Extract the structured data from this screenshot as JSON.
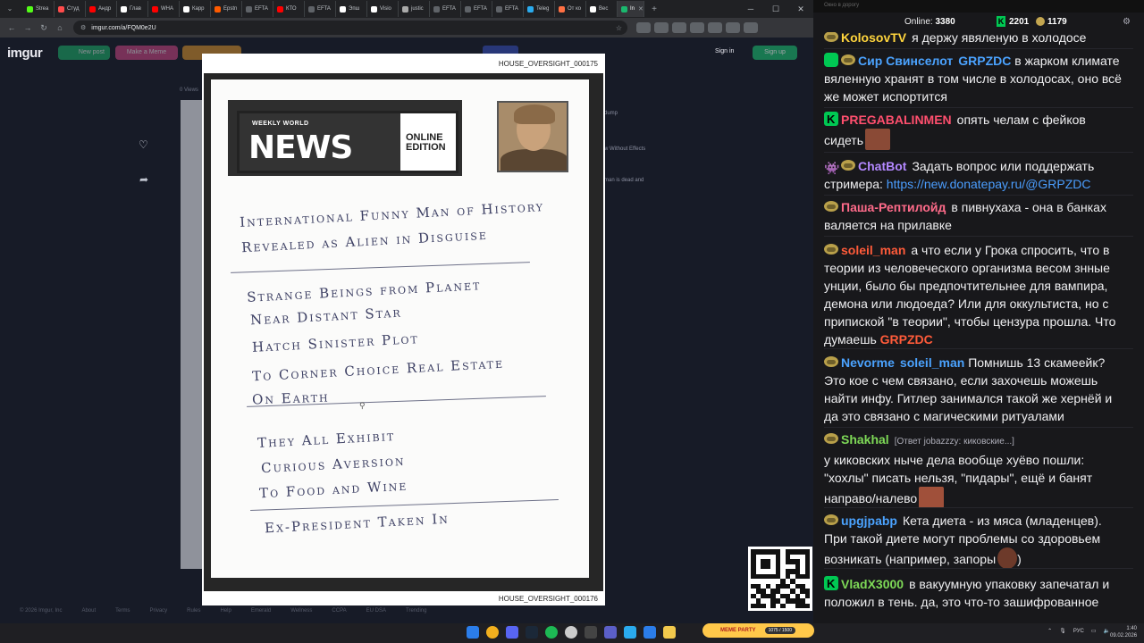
{
  "browser": {
    "tabs": [
      {
        "label": "Strea",
        "color": "#53fc18"
      },
      {
        "label": "Студ",
        "color": "#ff4b4b"
      },
      {
        "label": "Андр",
        "color": "#ff0000"
      },
      {
        "label": "Глав",
        "color": "#ffffff"
      },
      {
        "label": "WHA",
        "color": "#ff0000"
      },
      {
        "label": "Карр",
        "color": "#ffffff"
      },
      {
        "label": "Epstn",
        "color": "#ff5b00"
      },
      {
        "label": "EFTA",
        "color": "#5f6368"
      },
      {
        "label": "КТО",
        "color": "#ff0000"
      },
      {
        "label": "EFTA",
        "color": "#5f6368"
      },
      {
        "label": "Эпш",
        "color": "#ffffff"
      },
      {
        "label": "Visio",
        "color": "#ffffff"
      },
      {
        "label": "justic",
        "color": "#aaaaaa"
      },
      {
        "label": "EFTA",
        "color": "#5f6368"
      },
      {
        "label": "EFTA",
        "color": "#5f6368"
      },
      {
        "label": "EFTA",
        "color": "#5f6368"
      },
      {
        "label": "Teleg",
        "color": "#2aabee"
      },
      {
        "label": "От ко",
        "color": "#ff7043"
      },
      {
        "label": "Вес",
        "color": "#ffffff"
      },
      {
        "label": "In",
        "color": "#1bb76e"
      }
    ],
    "url": "imgur.com/a/FQM0e2U"
  },
  "imgur": {
    "logo": "imgur",
    "new_post": "New post",
    "make_meme": "Make a Meme",
    "views": "0 Views",
    "signin": "Sign in",
    "signup": "Sign up",
    "side_items": [
      "dump",
      "w Without Effects",
      "man is dead and"
    ],
    "footer": [
      "© 2026 Imgur, Inc",
      "About",
      "Terms",
      "Privacy",
      "Rules",
      "Help",
      "Emerald",
      "Wellness",
      "CCPA",
      "EU DSA",
      "Trending"
    ]
  },
  "lightbox": {
    "caption_top": "HOUSE_OVERSIGHT_000175",
    "caption_bottom": "HOUSE_OVERSIGHT_000176",
    "masthead_weekly": "WEEKLY WORLD",
    "masthead_news": "NEWS",
    "masthead_edition": "ONLINE EDITION",
    "lines": [
      "International Funny Man of History",
      "Revealed as Alien in Disguise",
      "Strange Beings from Planet",
      "Near Distant Star",
      "Hatch Sinister Plot",
      "To Corner Choice Real Estate",
      "On Earth",
      "They All Exhibit",
      "Curious Aversion",
      "To Food and Wine",
      "Ex-President Taken In"
    ]
  },
  "chat": {
    "top_title": "Окно в дорогу",
    "online_label": "Online:",
    "online_count": "3380",
    "kick_count": "2201",
    "points_count": "1179",
    "messages": [
      {
        "user": "KolosovTV",
        "color": "#ffd53d",
        "text": "я держу явяленую в холодосе"
      },
      {
        "user": "Сир Свинселот",
        "color": "#4ba3ff",
        "mention": "GRPZDC",
        "mention_color": "#4ba3ff",
        "text": "в жарком климате вяленную хранят в том числе в холодосах, оно всё же может испортится"
      },
      {
        "user": "PREGABALINMEN",
        "color": "#ff4f6e",
        "text": "опять челам с фейков сидеть"
      },
      {
        "user": "ChatBot",
        "color": "#b388ff",
        "text": "Задать вопрос или поддержать стримера:",
        "link": "https://new.donatepay.ru/@GRPZDC"
      },
      {
        "user": "Паша-Рептилойд",
        "color": "#ff6b8a",
        "text": "в пивнухаха - она в банках валяется на прилавке"
      },
      {
        "user": "soleil_man",
        "color": "#ff5b3a",
        "text": "а что если у Грока спросить, что в теории из человеческого организма весом знные унции, было бы предпочтительнее для вампира, демона или людоеда? Или для оккультиста, но с припиской \"в теории\", чтобы цензура прошла. Что думаешь",
        "mention": "GRPZDC",
        "mention_color": "#ff5b3a"
      },
      {
        "user": "Nevorme",
        "color": "#4ba3ff",
        "mention": "soleil_man",
        "mention_color": "#4ba3ff",
        "text": "Помнишь 13 скамеейк? Это кое с чем связано, если захочешь можешь найти инфу. Гитлер занимался такой же хернёй и да это связано с магическими ритуалами"
      },
      {
        "user": "Shakhal",
        "color": "#7ed957",
        "reply": "[Ответ jobazzzy: киковские...]",
        "text": "у киковских ныче дела вообще хуёво пошли: \"хохлы\" писать нельзя, \"пидары\", ещё и банят направо/налево"
      },
      {
        "user": "upgjpabp",
        "color": "#4ba3ff",
        "text": "Кета диета - из мяса (младенцев). При такой диете могут проблемы со здоровьем возникать (например, запоры"
      },
      {
        "user": "VladX3000",
        "color": "#7ed957",
        "text": "в вакуумную упаковку запечатал и положил в тень. да, это что-то зашифрованное"
      }
    ]
  },
  "taskbar": {
    "meme_party": "MEME PARTY",
    "meme_value": "1075 / 1500",
    "lang": "РУС",
    "time": "1:40",
    "date": "09.02.2026"
  }
}
